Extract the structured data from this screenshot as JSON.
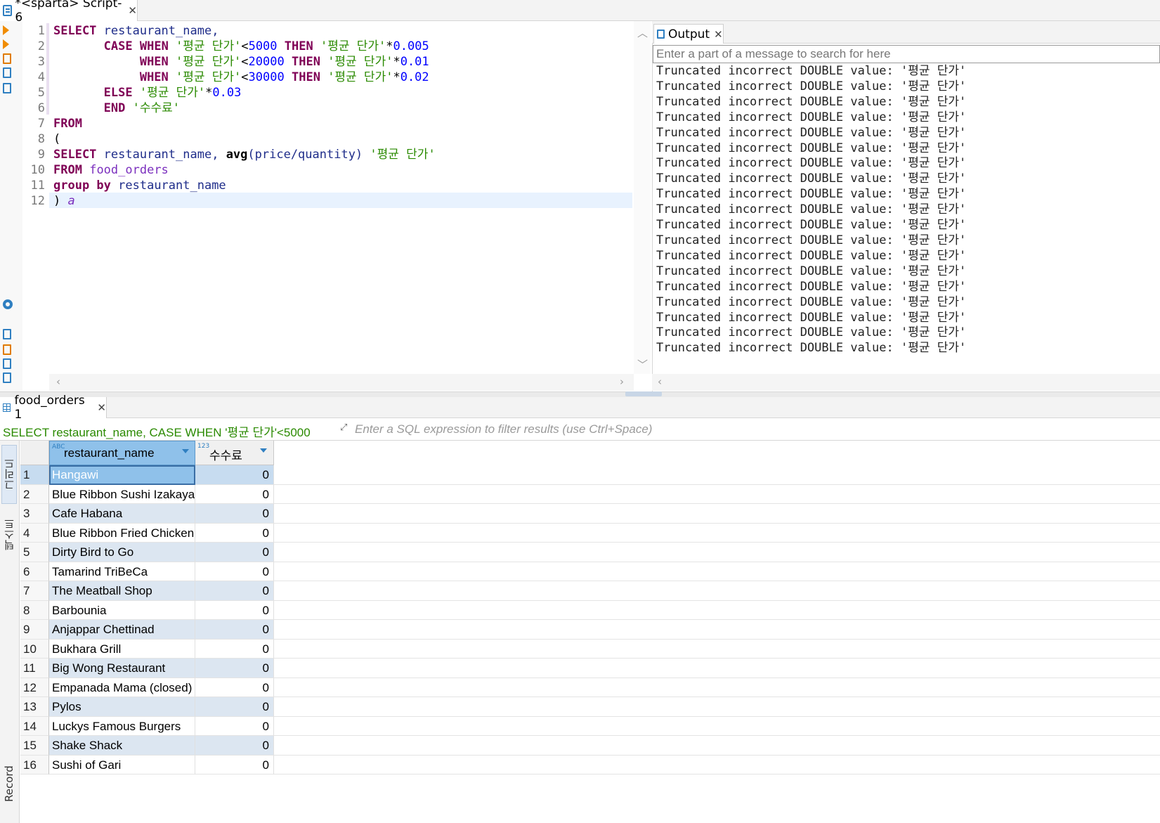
{
  "editor_tab": {
    "title": "*<sparta> Script-6",
    "close": "✕"
  },
  "editor": {
    "line_numbers": [
      "1",
      "2",
      "3",
      "4",
      "5",
      "6",
      "7",
      "8",
      "9",
      "10",
      "11",
      "12"
    ],
    "code": {
      "l1": {
        "kw": "SELECT",
        "rest": "restaurant_name,"
      },
      "l2": {
        "case": "CASE",
        "when": "WHEN",
        "str": "'평균 단가'",
        "op": "<",
        "num": "5000",
        "then": "THEN",
        "str2": "'평균 단가'",
        "op2": "*",
        "num2": "0.005"
      },
      "l3": {
        "when": "WHEN",
        "str": "'평균 단가'",
        "op": "<",
        "num": "20000",
        "then": "THEN",
        "str2": "'평균 단가'",
        "op2": "*",
        "num2": "0.01"
      },
      "l4": {
        "when": "WHEN",
        "str": "'평균 단가'",
        "op": "<",
        "num": "30000",
        "then": "THEN",
        "str2": "'평균 단가'",
        "op2": "*",
        "num2": "0.02"
      },
      "l5": {
        "else": "ELSE",
        "str": "'평균 단가'",
        "op": "*",
        "num": "0.03"
      },
      "l6": {
        "end": "END",
        "str": "'수수료'"
      },
      "l7": {
        "kw": "FROM"
      },
      "l8": {
        "op": "("
      },
      "l9": {
        "kw": "SELECT",
        "id": "restaurant_name,",
        "fn": "avg",
        "args": "(price/quantity)",
        "str": "'평균 단가'"
      },
      "l10": {
        "kw": "FROM",
        "tbl": "food_orders"
      },
      "l11": {
        "kw": "group by",
        "id": "restaurant_name"
      },
      "l12": {
        "op": ")",
        "alias": "a"
      }
    }
  },
  "output": {
    "tab_label": "Output",
    "close": "✕",
    "search_placeholder": "Enter a part of a message to search for here",
    "lines": [
      "Truncated incorrect DOUBLE value: '평균 단가'",
      "Truncated incorrect DOUBLE value: '평균 단가'",
      "Truncated incorrect DOUBLE value: '평균 단가'",
      "Truncated incorrect DOUBLE value: '평균 단가'",
      "Truncated incorrect DOUBLE value: '평균 단가'",
      "Truncated incorrect DOUBLE value: '평균 단가'",
      "Truncated incorrect DOUBLE value: '평균 단가'",
      "Truncated incorrect DOUBLE value: '평균 단가'",
      "Truncated incorrect DOUBLE value: '평균 단가'",
      "Truncated incorrect DOUBLE value: '평균 단가'",
      "Truncated incorrect DOUBLE value: '평균 단가'",
      "Truncated incorrect DOUBLE value: '평균 단가'",
      "Truncated incorrect DOUBLE value: '평균 단가'",
      "Truncated incorrect DOUBLE value: '평균 단가'",
      "Truncated incorrect DOUBLE value: '평균 단가'",
      "Truncated incorrect DOUBLE value: '평균 단가'",
      "Truncated incorrect DOUBLE value: '평균 단가'",
      "Truncated incorrect DOUBLE value: '평균 단가'",
      "Truncated incorrect DOUBLE value: '평균 단가'"
    ]
  },
  "results": {
    "tab_label": "food_orders 1",
    "close": "✕",
    "query_preview": "SELECT restaurant_name, CASE WHEN '평균 단가'<5000",
    "filter_placeholder": "Enter a SQL expression to filter results (use Ctrl+Space)",
    "side_tabs": {
      "grid": "그리드",
      "text": "텍스트",
      "record": "Record"
    },
    "columns": [
      {
        "type_tag": "ABC",
        "label": "restaurant_name"
      },
      {
        "type_tag": "123",
        "label": "수수료"
      }
    ],
    "rows": [
      {
        "n": "1",
        "name": "Hangawi",
        "fee": "0"
      },
      {
        "n": "2",
        "name": "Blue Ribbon Sushi Izakaya",
        "fee": "0"
      },
      {
        "n": "3",
        "name": "Cafe Habana",
        "fee": "0"
      },
      {
        "n": "4",
        "name": "Blue Ribbon Fried Chicken",
        "fee": "0"
      },
      {
        "n": "5",
        "name": "Dirty Bird to Go",
        "fee": "0"
      },
      {
        "n": "6",
        "name": "Tamarind TriBeCa",
        "fee": "0"
      },
      {
        "n": "7",
        "name": "The Meatball Shop",
        "fee": "0"
      },
      {
        "n": "8",
        "name": "Barbounia",
        "fee": "0"
      },
      {
        "n": "9",
        "name": "Anjappar Chettinad",
        "fee": "0"
      },
      {
        "n": "10",
        "name": "Bukhara Grill",
        "fee": "0"
      },
      {
        "n": "11",
        "name": "Big Wong Restaurant",
        "fee": "0"
      },
      {
        "n": "12",
        "name": "Empanada Mama (closed)",
        "fee": "0"
      },
      {
        "n": "13",
        "name": "Pylos",
        "fee": "0"
      },
      {
        "n": "14",
        "name": "Luckys Famous Burgers",
        "fee": "0"
      },
      {
        "n": "15",
        "name": "Shake Shack",
        "fee": "0"
      },
      {
        "n": "16",
        "name": "Sushi of Gari",
        "fee": "0"
      }
    ]
  },
  "colors": {
    "keyword": "#7f0055",
    "string": "#2a8a00",
    "number": "#0000ff",
    "selection": "#8fc1ea",
    "alt_row": "#dce6f1"
  }
}
